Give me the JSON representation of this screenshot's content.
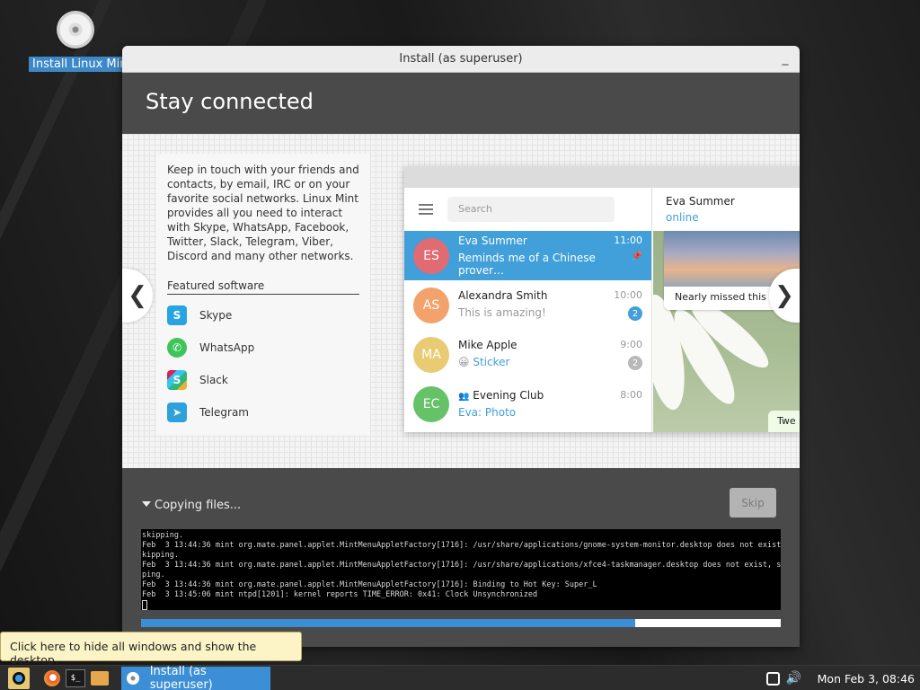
{
  "desktop": {
    "icon_label": "Install Linux Mint"
  },
  "window": {
    "title": "Install (as superuser)",
    "minimize_glyph": "_"
  },
  "slide": {
    "heading": "Stay connected",
    "description": "Keep in touch with your friends and contacts, by email, IRC or on your favorite social networks. Linux Mint provides all you need to interact with Skype, WhatsApp, Facebook, Twitter, Slack, Telegram, Viber, Discord and many other networks.",
    "featured_title": "Featured software",
    "apps": [
      {
        "name": "Skype",
        "icon": "skype-icon",
        "glyph": "S"
      },
      {
        "name": "WhatsApp",
        "icon": "whatsapp-icon",
        "glyph": "✆"
      },
      {
        "name": "Slack",
        "icon": "slack-icon",
        "glyph": "S"
      },
      {
        "name": "Telegram",
        "icon": "telegram-icon",
        "glyph": "➤"
      }
    ],
    "prev_glyph": "❮",
    "next_glyph": "❯"
  },
  "telegram": {
    "search_placeholder": "Search",
    "chats": [
      {
        "initials": "ES",
        "name": "Eva Summer",
        "time": "11:00",
        "message": "Reminds me of a Chinese prover…",
        "pinned": "📌",
        "color": "#e06b72",
        "active": true
      },
      {
        "initials": "AS",
        "name": "Alexandra Smith",
        "time": "10:00",
        "message": "This is amazing!",
        "badge": "2",
        "color": "#f2a26a"
      },
      {
        "initials": "MA",
        "name": "Mike Apple",
        "time": "9:00",
        "emoji": "😀",
        "message": "Sticker",
        "badge": "2",
        "color": "#e8cb73"
      },
      {
        "initials": "EC",
        "name": "Evening Club",
        "time": "8:00",
        "group_glyph": "👥",
        "message": "Eva: Photo",
        "color": "#66c267"
      }
    ],
    "header_name": "Eva Summer",
    "header_status": "online",
    "photo_caption": "Nearly missed this s",
    "tweet_text": "Twe"
  },
  "installer": {
    "progress_label": "Copying files...",
    "skip_label": "Skip",
    "terminal_lines": [
      "skipping.",
      "Feb  3 13:44:36 mint org.mate.panel.applet.MintMenuAppletFactory[1716]: /usr/share/applications/gnome-system-monitor.desktop does not exist, s",
      "kipping.",
      "Feb  3 13:44:36 mint org.mate.panel.applet.MintMenuAppletFactory[1716]: /usr/share/applications/xfce4-taskmanager.desktop does not exist, skip",
      "ping.",
      "Feb  3 13:44:36 mint org.mate.panel.applet.MintMenuAppletFactory[1716]: Binding to Hot Key: Super_L",
      "Feb  3 13:45:06 mint ntpd[1201]: kernel reports TIME_ERROR: 0x41: Clock Unsynchronized"
    ],
    "progress_fraction": 0.772
  },
  "tooltip": "Click here to hide all windows and show the desktop.",
  "panel": {
    "task_label": "Install (as superuser)",
    "volume_glyph": "🔊",
    "clock": "Mon Feb  3, 08:46"
  },
  "colors": {
    "accent": "#3c8fd6",
    "telegram_blue": "#419fd9"
  }
}
